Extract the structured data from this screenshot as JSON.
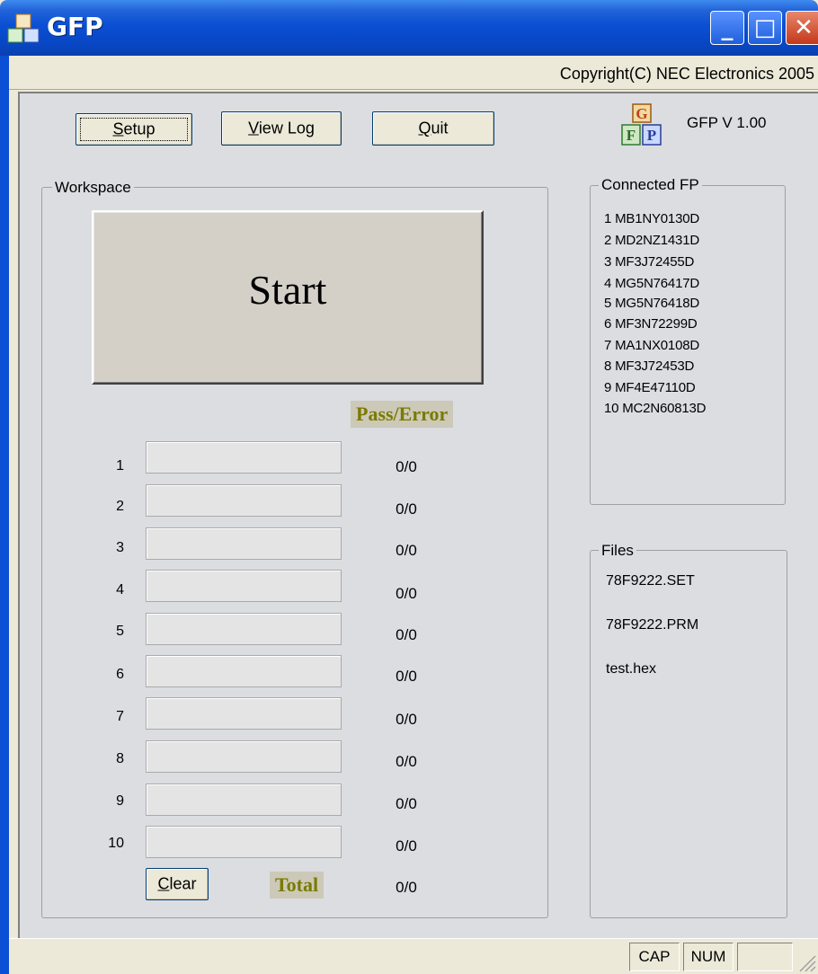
{
  "window": {
    "title": "GFP",
    "app_icon": "gfp-logo-icon",
    "controls": [
      "minimize-icon",
      "maximize-icon",
      "close-icon"
    ]
  },
  "copyright": "Copyright(C) NEC Electronics 2005",
  "toolbar": {
    "setup_label": "Setup",
    "setup_mnemonic": "S",
    "setup_rest": "etup",
    "viewlog_mnemonic": "V",
    "viewlog_rest": "iew Log",
    "quit_mnemonic": "Q",
    "quit_rest": "uit"
  },
  "version": "GFP V 1.00",
  "logo_letters": [
    "G",
    "F",
    "P"
  ],
  "workspace": {
    "legend": "Workspace",
    "start_label": "Start",
    "pass_error_label": "Pass/Error",
    "rows": [
      {
        "num": "1",
        "value": "0/0",
        "progress": 0
      },
      {
        "num": "2",
        "value": "0/0",
        "progress": 0
      },
      {
        "num": "3",
        "value": "0/0",
        "progress": 0
      },
      {
        "num": "4",
        "value": "0/0",
        "progress": 0
      },
      {
        "num": "5",
        "value": "0/0",
        "progress": 0
      },
      {
        "num": "6",
        "value": "0/0",
        "progress": 0
      },
      {
        "num": "7",
        "value": "0/0",
        "progress": 0
      },
      {
        "num": "8",
        "value": "0/0",
        "progress": 0
      },
      {
        "num": "9",
        "value": "0/0",
        "progress": 0
      },
      {
        "num": "10",
        "value": "0/0",
        "progress": 0
      }
    ],
    "clear_mnemonic": "C",
    "clear_rest": "lear",
    "total_label": "Total",
    "total_value": "0/0"
  },
  "connected_fp": {
    "legend": "Connected FP",
    "items": [
      "1 MB1NY0130D",
      "2 MD2NZ1431D",
      "3 MF3J72455D",
      "4 MG5N76417D",
      "5 MG5N76418D",
      "6 MF3N72299D",
      "7 MA1NX0108D",
      "8 MF3J72453D",
      "9 MF4E47110D",
      "10 MC2N60813D"
    ]
  },
  "files": {
    "legend": "Files",
    "items": [
      "78F9222.SET",
      "78F9222.PRM",
      "test.hex"
    ]
  },
  "statusbar": {
    "cap": "CAP",
    "num": "NUM"
  },
  "colors": {
    "titlebar": "#0a4fd4",
    "pass_error_text": "#7a7a00",
    "panel_bg": "#dcdde1"
  }
}
